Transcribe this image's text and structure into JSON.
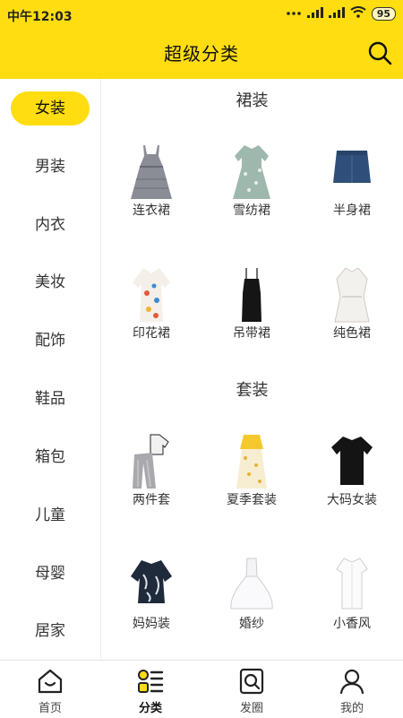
{
  "status_bar": {
    "time": "中午12:03",
    "battery": "95"
  },
  "header": {
    "title": "超级分类"
  },
  "sidebar": {
    "items": [
      {
        "label": "女装"
      },
      {
        "label": "男装"
      },
      {
        "label": "内衣"
      },
      {
        "label": "美妆"
      },
      {
        "label": "配饰"
      },
      {
        "label": "鞋品"
      },
      {
        "label": "箱包"
      },
      {
        "label": "儿童"
      },
      {
        "label": "母婴"
      },
      {
        "label": "居家"
      }
    ],
    "active": "女装"
  },
  "sections": [
    {
      "title": "裙装",
      "items": [
        {
          "label": "连衣裙",
          "icon": "sleeveless-dress-icon"
        },
        {
          "label": "雪纺裙",
          "icon": "chiffon-dress-icon"
        },
        {
          "label": "半身裙",
          "icon": "denim-skirt-icon"
        },
        {
          "label": "印花裙",
          "icon": "printed-dress-icon"
        },
        {
          "label": "吊带裙",
          "icon": "slip-dress-icon"
        },
        {
          "label": "纯色裙",
          "icon": "white-dress-icon"
        }
      ]
    },
    {
      "title": "套装",
      "items": [
        {
          "label": "两件套",
          "icon": "two-piece-set-icon"
        },
        {
          "label": "夏季套装",
          "icon": "summer-set-icon"
        },
        {
          "label": "大码女装",
          "icon": "plus-size-tee-icon"
        },
        {
          "label": "妈妈装",
          "icon": "mom-wear-icon"
        },
        {
          "label": "婚纱",
          "icon": "wedding-dress-icon"
        },
        {
          "label": "小香风",
          "icon": "chanel-style-icon"
        }
      ]
    }
  ],
  "bottom_nav": {
    "items": [
      {
        "label": "首页",
        "icon": "home-icon"
      },
      {
        "label": "分类",
        "icon": "category-icon"
      },
      {
        "label": "发圈",
        "icon": "share-circle-icon"
      },
      {
        "label": "我的",
        "icon": "profile-icon"
      }
    ],
    "active": "分类"
  },
  "colors": {
    "accent": "#FFDD11",
    "text": "#333333",
    "divider": "#eeeeee"
  }
}
